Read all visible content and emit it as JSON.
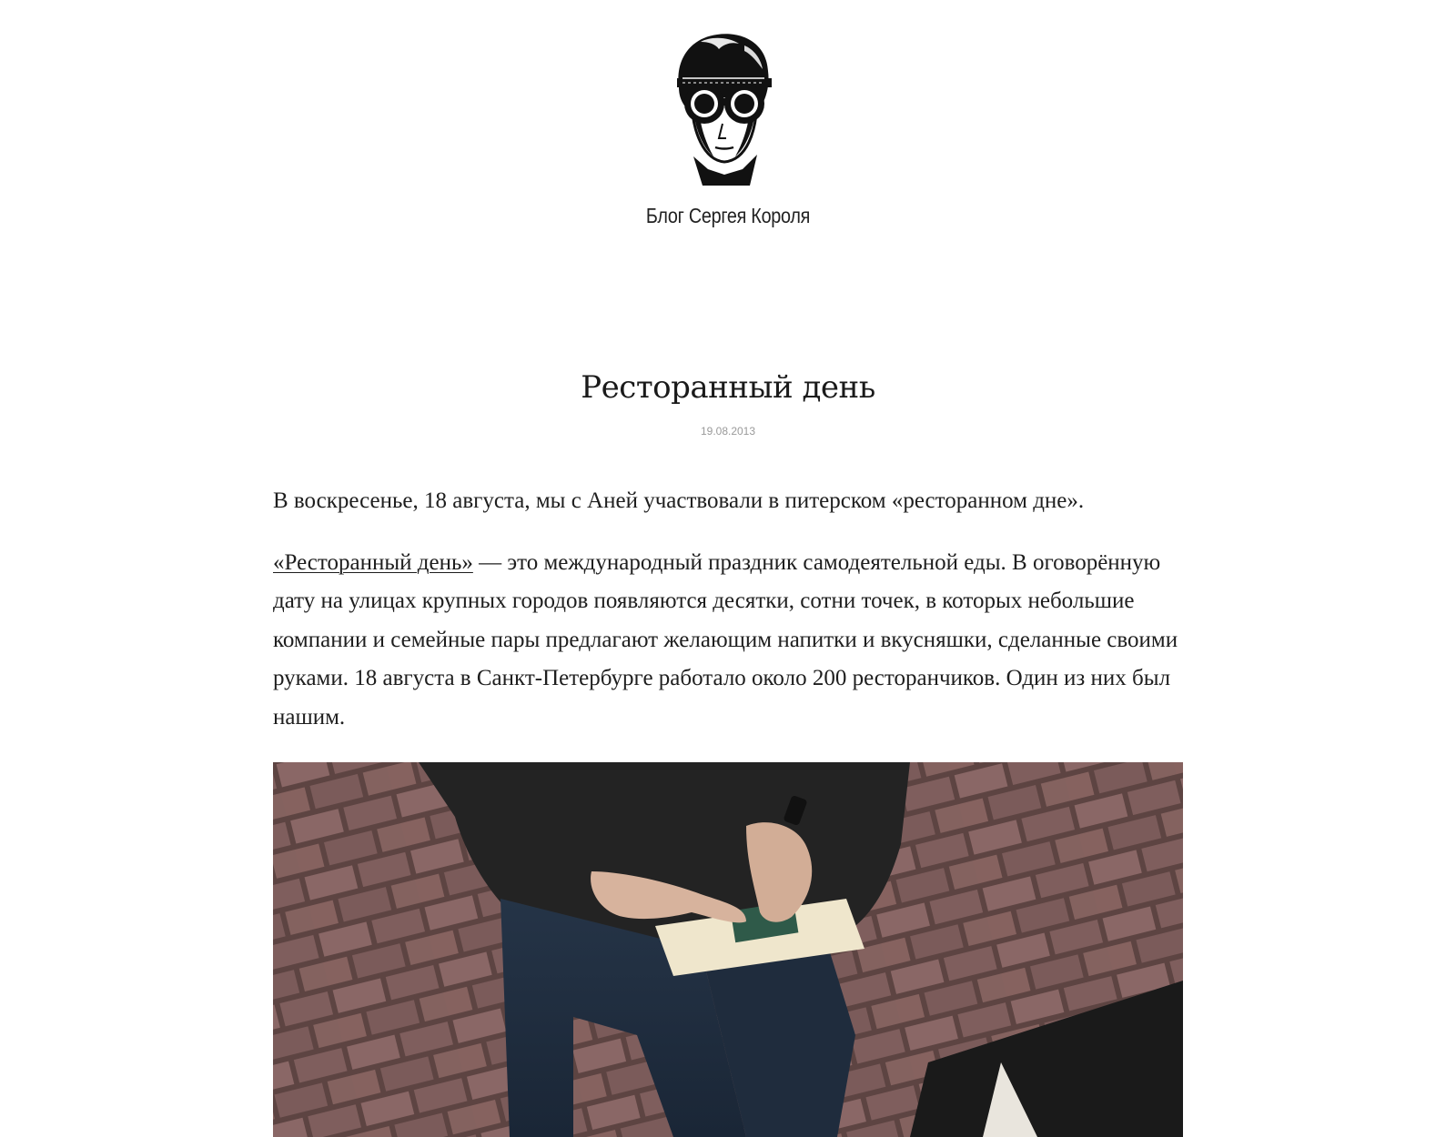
{
  "header": {
    "logo_icon": "goggles-portrait-logo",
    "site_title": "Блог Сергея Короля"
  },
  "post": {
    "title": "Ресторанный день",
    "date": "19.08.2013",
    "intro": "В воскресенье, 18 августа, мы с Аней участвовали в питерском «ресторанном дне».",
    "lead_link": "«Ресторанный день»",
    "lead_rest": " — это международный праздник самодеятельной еды. В оговорённую дату на улицах крупных городов появляются десятки, сотни точек, в которых небольшие компании и семейные пары предлагают желающим напитки и вкусняшки, сделанные своими руками. 18 августа в Санкт-Петербурге работало около 200 ресторанчиков. Один из них был нашим.",
    "photo_icon": "photo-person-holding-card"
  }
}
